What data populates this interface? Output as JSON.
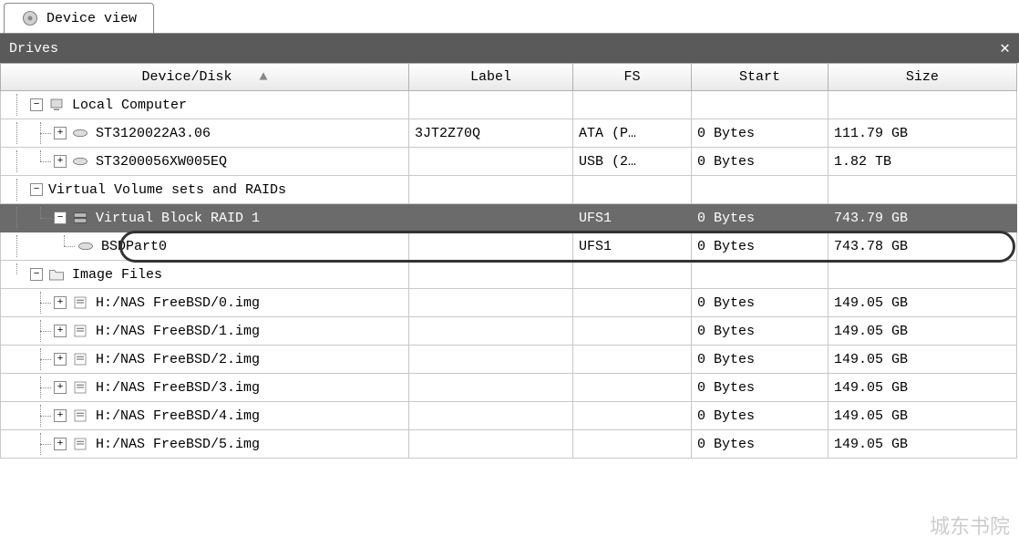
{
  "tab": {
    "label": "Device view"
  },
  "panel": {
    "title": "Drives",
    "close": "✕"
  },
  "columns": {
    "device": "Device/Disk",
    "label": "Label",
    "fs": "FS",
    "start": "Start",
    "size": "Size"
  },
  "tree": {
    "local": {
      "name": "Local Computer",
      "children": [
        {
          "name": "ST3120022A3.06",
          "label": "3JT2Z70Q",
          "fs": "ATA (P…",
          "start": "0 Bytes",
          "size": "111.79 GB"
        },
        {
          "name": "ST3200056XW005EQ",
          "label": "",
          "fs": "USB (2…",
          "start": "0 Bytes",
          "size": "1.82 TB"
        }
      ]
    },
    "virtual": {
      "name": "Virtual Volume sets and RAIDs",
      "raid": {
        "name": "Virtual Block RAID 1",
        "label": "",
        "fs": "UFS1",
        "start": "0 Bytes",
        "size": "743.79 GB",
        "part": {
          "name": "BSDPart0",
          "label": "",
          "fs": "UFS1",
          "start": "0 Bytes",
          "size": "743.78 GB"
        }
      }
    },
    "images": {
      "name": "Image Files",
      "children": [
        {
          "name": "H:/NAS FreeBSD/0.img",
          "start": "0 Bytes",
          "size": "149.05 GB"
        },
        {
          "name": "H:/NAS FreeBSD/1.img",
          "start": "0 Bytes",
          "size": "149.05 GB"
        },
        {
          "name": "H:/NAS FreeBSD/2.img",
          "start": "0 Bytes",
          "size": "149.05 GB"
        },
        {
          "name": "H:/NAS FreeBSD/3.img",
          "start": "0 Bytes",
          "size": "149.05 GB"
        },
        {
          "name": "H:/NAS FreeBSD/4.img",
          "start": "0 Bytes",
          "size": "149.05 GB"
        },
        {
          "name": "H:/NAS FreeBSD/5.img",
          "start": "0 Bytes",
          "size": "149.05 GB"
        }
      ]
    }
  },
  "glyph": {
    "plus": "+",
    "minus": "−",
    "sort": "▲"
  },
  "watermark": "城东书院"
}
